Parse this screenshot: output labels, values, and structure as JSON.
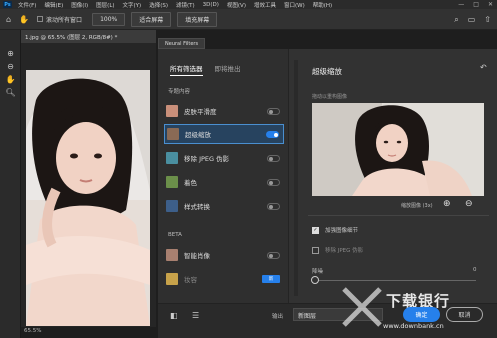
{
  "menubar": {
    "logo": "Ps",
    "items": [
      "文件(F)",
      "编辑(E)",
      "图像(I)",
      "图层(L)",
      "文字(Y)",
      "选择(S)",
      "滤镜(T)",
      "3D(D)",
      "视图(V)",
      "增效工具",
      "窗口(W)",
      "帮助(H)"
    ],
    "controls": [
      "—",
      "□",
      "✕"
    ]
  },
  "optionsbar": {
    "scroll_all_label": "滚动所有窗口",
    "zoom_value": "100%",
    "fit_screen_label": "适合屏幕",
    "fill_screen_label": "填充屏幕"
  },
  "document": {
    "tab_title": "1.jpg @ 65.5% (图层 2, RGB/8#) *",
    "zoom_status": "65.5%"
  },
  "neural_filters": {
    "panel_tab": "Neural Filters",
    "tabs": [
      "所有筛选器",
      "即将推出"
    ],
    "section_featured": "专题内容",
    "section_beta": "BETA",
    "filters": [
      {
        "label": "皮肤平滑度",
        "on": false
      },
      {
        "label": "超级缩放",
        "on": true
      },
      {
        "label": "移除 JPEG 伪影",
        "on": false
      },
      {
        "label": "着色",
        "on": false
      },
      {
        "label": "样式转换",
        "on": false
      }
    ],
    "beta_filters": [
      {
        "label": "智能肖像",
        "on": false
      },
      {
        "label": "妆容",
        "badge": "新"
      }
    ],
    "detail": {
      "title": "超级缩放",
      "hint": "拖动以重构图像",
      "zoom_label": "缩放图像 (3x)",
      "options": [
        {
          "label": "加强图像细节",
          "checked": true
        },
        {
          "label": "移除 JPEG 伪影",
          "checked": false
        }
      ],
      "noise_label": "降噪",
      "noise_value": "0"
    },
    "output_label": "输出",
    "output_value": "新图层",
    "ok_label": "确定",
    "cancel_label": "取消"
  },
  "watermark": {
    "text": "下载银行",
    "sub": "www.downbank.cn"
  },
  "colors": {
    "accent": "#2680eb",
    "panel": "#323232",
    "background": "#1e1e1e"
  }
}
